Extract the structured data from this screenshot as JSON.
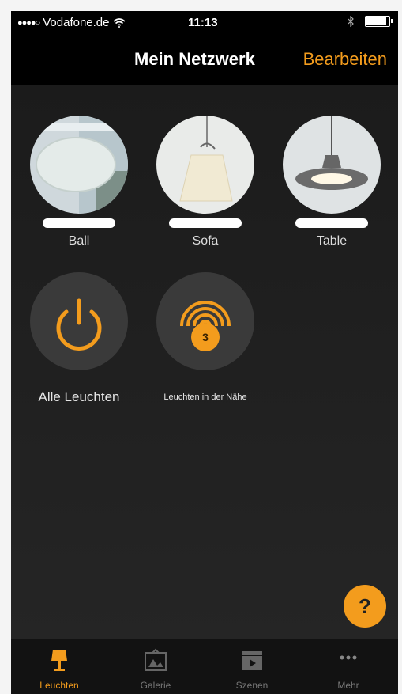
{
  "status_bar": {
    "signal_dots": "●●●●○",
    "carrier": "Vodafone.de",
    "wifi_icon": "wifi-icon",
    "time": "11:13",
    "bluetooth_icon": "bluetooth-icon",
    "battery_level": 0.95
  },
  "nav": {
    "title": "Mein Netzwerk",
    "edit_label": "Bearbeiten"
  },
  "lamps": [
    {
      "label": "Ball",
      "icon": "lamp-photo-ball"
    },
    {
      "label": "Sofa",
      "icon": "lamp-photo-sofa"
    },
    {
      "label": "Table",
      "icon": "lamp-photo-table"
    }
  ],
  "tiles": {
    "all_lights": {
      "label": "Alle Leuchten",
      "icon": "power-icon"
    },
    "nearby": {
      "label": "Leuchten in der Nähe",
      "icon": "signal-waves-icon",
      "count": "3"
    }
  },
  "help": {
    "label": "?"
  },
  "tab_bar": {
    "tabs": [
      {
        "label": "Leuchten",
        "icon": "lamp-icon",
        "active": true
      },
      {
        "label": "Galerie",
        "icon": "gallery-icon",
        "active": false
      },
      {
        "label": "Szenen",
        "icon": "scenes-icon",
        "active": false
      },
      {
        "label": "Mehr",
        "icon": "more-icon",
        "active": false
      }
    ]
  },
  "colors": {
    "accent": "#f39c1d",
    "background": "#1c1c1c",
    "tile": "#3a3a3a"
  }
}
